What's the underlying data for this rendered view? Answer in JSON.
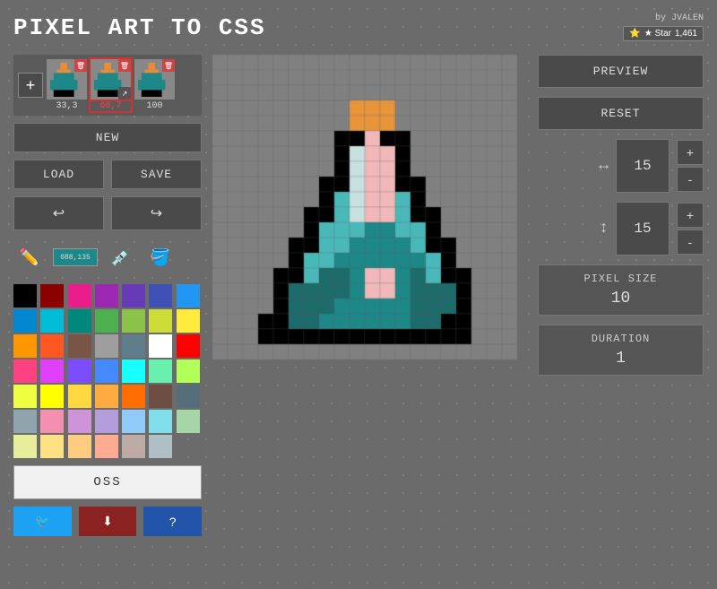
{
  "app": {
    "title": "PIXEL ART TO CSS",
    "author": "by JVALEN",
    "star_label": "★ Star",
    "star_count": "1,461"
  },
  "toolbar": {
    "new_label": "NEW",
    "load_label": "LOAD",
    "save_label": "SAVE",
    "preview_label": "PREVIEW",
    "reset_label": "RESET",
    "oss_label": "OSS"
  },
  "frames": [
    {
      "id": 1,
      "label": "33,3",
      "active": false
    },
    {
      "id": 2,
      "label": "66,7",
      "active": true
    },
    {
      "id": 3,
      "label": "100",
      "active": false
    }
  ],
  "size_controls": {
    "width_value": "15",
    "height_value": "15",
    "plus_label": "+",
    "minus_label": "-"
  },
  "pixel_size": {
    "label": "Pixel Size",
    "value": "10"
  },
  "duration": {
    "label": "Duration",
    "value": "1"
  },
  "social": {
    "twitter_icon": "🐦",
    "download_icon": "⬇",
    "help_icon": "?"
  },
  "colors": {
    "current": "#1e8788",
    "display_text": "088,135",
    "palette": [
      "#000000",
      "#8b0000",
      "#e91e8c",
      "#9c27b0",
      "#673ab7",
      "#3f51b5",
      "#2196f3",
      "#0288d1",
      "#00bcd4",
      "#00897b",
      "#4caf50",
      "#8bc34a",
      "#cddc39",
      "#ffeb3b",
      "#ff9800",
      "#ff5722",
      "#795548",
      "#9e9e9e",
      "#607d8b",
      "#ffffff",
      "#ff0000",
      "#ff4081",
      "#e040fb",
      "#7c4dff",
      "#448aff",
      "#18ffff",
      "#69f0ae",
      "#b2ff59",
      "#eeff41",
      "#ffff00",
      "#ffd740",
      "#ffab40",
      "#ff6d00",
      "#6d4c41",
      "#546e7a",
      "#90a4ae",
      "#f48fb1",
      "#ce93d8",
      "#b39ddb",
      "#90caf9",
      "#80deea",
      "#a5d6a7",
      "#e6ee9c",
      "#ffe082",
      "#ffcc80",
      "#ffab91",
      "#bcaaa4",
      "#b0bec5"
    ]
  },
  "canvas": {
    "cols": 20,
    "rows": 20,
    "pixels": "see script"
  }
}
